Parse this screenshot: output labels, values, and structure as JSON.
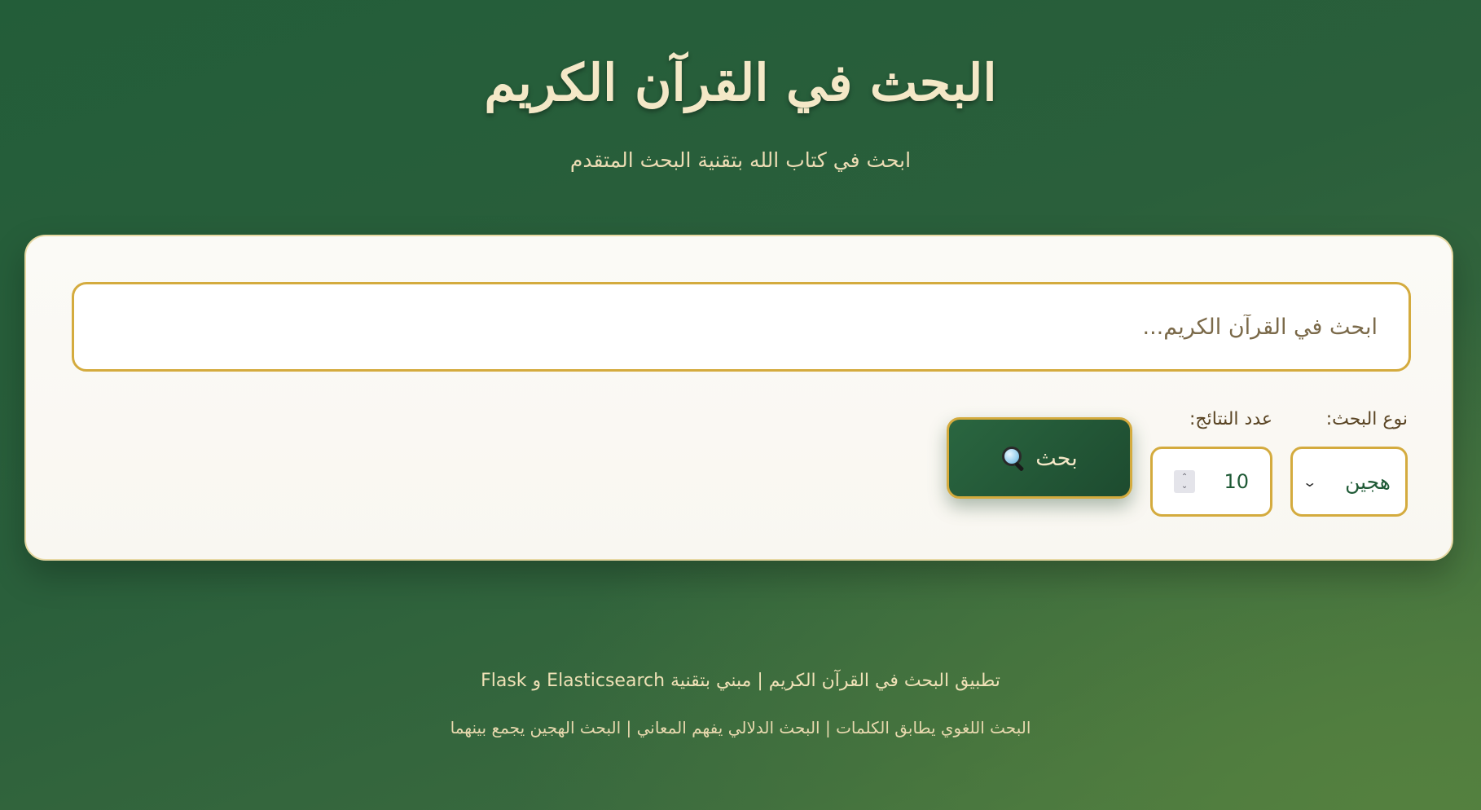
{
  "header": {
    "title": "البحث في القرآن الكريم",
    "subtitle": "ابحث في كتاب الله بتقنية البحث المتقدم"
  },
  "search": {
    "placeholder": "ابحث في القرآن الكريم...",
    "value": ""
  },
  "controls": {
    "search_type_label": "نوع البحث:",
    "search_type_value": "هجين",
    "results_count_label": "عدد النتائج:",
    "results_count_value": "10",
    "search_button_label": "بحث"
  },
  "footer": {
    "line1": "تطبيق البحث في القرآن الكريم | مبني بتقنية Elasticsearch و Flask",
    "line2": "البحث اللغوي يطابق الكلمات | البحث الدلالي يفهم المعاني | البحث الهجين يجمع بينهما"
  },
  "colors": {
    "background_green": "#2a5f3b",
    "accent_gold": "#d4ab3e",
    "button_green": "#1d4b2f",
    "title_cream": "#f4e8c7"
  },
  "icons": {
    "search_button_icon": "magnifier-icon",
    "select_icon": "chevron-down-icon",
    "stepper_icon": "stepper-arrows-icon"
  }
}
